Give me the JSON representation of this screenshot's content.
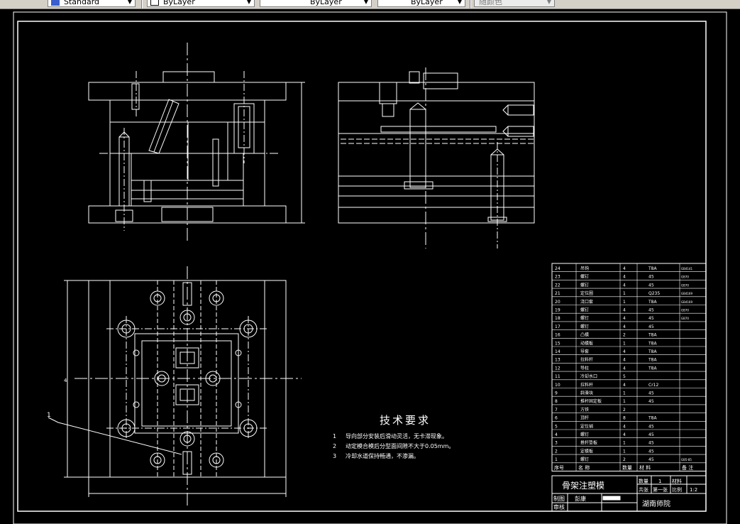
{
  "toolbar": {
    "textstyle_value": "Standard",
    "layer_value": "ByLayer",
    "linetype_value": "ByLayer",
    "lineweight_value": "ByLayer",
    "plotstyle_value": "随颜色",
    "icons": [
      "textstyle-icon",
      "layer-swatch-icon"
    ]
  },
  "drawing": {
    "tech_title": "技术要求",
    "tech_notes": [
      {
        "num": "1",
        "text": "导向部分安装后滑动灵活，无卡滞现象。"
      },
      {
        "num": "2",
        "text": "动定模合模后分型面间隙不大于0.05mm。"
      },
      {
        "num": "3",
        "text": "冷却水道保持畅通，不渗漏。"
      }
    ],
    "leader_label": "1",
    "dim_left": "4",
    "bom_rows": [
      {
        "no": "24",
        "name": "吊钩",
        "qty": "4",
        "mat": "T8A",
        "note": "GB4141"
      },
      {
        "no": "23",
        "name": "螺钉",
        "qty": "4",
        "mat": "45",
        "note": "GB70"
      },
      {
        "no": "22",
        "name": "螺钉",
        "qty": "4",
        "mat": "45",
        "note": "GB70"
      },
      {
        "no": "21",
        "name": "定位圈",
        "qty": "1",
        "mat": "Q235",
        "note": "GB4169"
      },
      {
        "no": "20",
        "name": "浇口套",
        "qty": "1",
        "mat": "T8A",
        "note": "GB4169"
      },
      {
        "no": "19",
        "name": "螺钉",
        "qty": "4",
        "mat": "45",
        "note": "GB70"
      },
      {
        "no": "18",
        "name": "螺钉",
        "qty": "4",
        "mat": "45",
        "note": "GB70"
      },
      {
        "no": "17",
        "name": "螺钉",
        "qty": "4",
        "mat": "45",
        "note": ""
      },
      {
        "no": "16",
        "name": "凸模",
        "qty": "2",
        "mat": "T8A",
        "note": ""
      },
      {
        "no": "15",
        "name": "动模板",
        "qty": "1",
        "mat": "T8A",
        "note": ""
      },
      {
        "no": "14",
        "name": "导套",
        "qty": "4",
        "mat": "T8A",
        "note": ""
      },
      {
        "no": "13",
        "name": "拉料杆",
        "qty": "4",
        "mat": "T8A",
        "note": ""
      },
      {
        "no": "12",
        "name": "导柱",
        "qty": "4",
        "mat": "T8A",
        "note": ""
      },
      {
        "no": "11",
        "name": "冷却水口",
        "qty": "5",
        "mat": "",
        "note": ""
      },
      {
        "no": "10",
        "name": "拉料杆",
        "qty": "4",
        "mat": "Cr12",
        "note": ""
      },
      {
        "no": "9",
        "name": "斜滑块",
        "qty": "1",
        "mat": "45",
        "note": ""
      },
      {
        "no": "8",
        "name": "推杆固定板",
        "qty": "1",
        "mat": "45",
        "note": ""
      },
      {
        "no": "7",
        "name": "方铁",
        "qty": "2",
        "mat": "",
        "note": ""
      },
      {
        "no": "6",
        "name": "顶杆",
        "qty": "8",
        "mat": "T8A",
        "note": ""
      },
      {
        "no": "5",
        "name": "定位销",
        "qty": "4",
        "mat": "45",
        "note": ""
      },
      {
        "no": "4",
        "name": "螺钉",
        "qty": "4",
        "mat": "45",
        "note": ""
      },
      {
        "no": "3",
        "name": "推杆垫板",
        "qty": "1",
        "mat": "45",
        "note": ""
      },
      {
        "no": "2",
        "name": "定模板",
        "qty": "1",
        "mat": "45",
        "note": ""
      },
      {
        "no": "1",
        "name": "螺钉",
        "qty": "2",
        "mat": "45",
        "note": "GB5-85"
      }
    ],
    "bom_header": {
      "no": "序号",
      "name": "名  称",
      "qty": "数量",
      "mat": "材  料",
      "note": "备  注"
    },
    "title_block": {
      "part_name": "骨架注塑模",
      "qty_label": "数量",
      "qty_value": "1",
      "material_label": "材料",
      "sheet_label": "共张",
      "sheet_of": "第一张",
      "scale_label": "比例",
      "scale_value": "1:2",
      "drawn_label": "制图",
      "drawn_name": "彭康",
      "review_label": "审核",
      "school": "湖南师院"
    },
    "colors": {
      "background": "#000000",
      "lines": "#ffffff",
      "toolbar": "#d4d0c8"
    }
  }
}
